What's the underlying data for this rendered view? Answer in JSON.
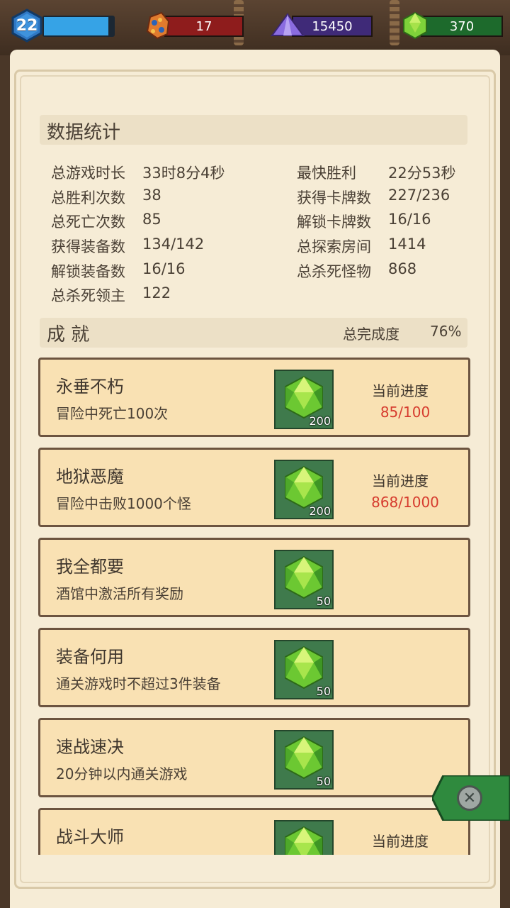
{
  "topbar": {
    "level": "22",
    "xp_fraction": 0.93,
    "resources": [
      {
        "name": "ore",
        "icon": "ore-icon",
        "value": "17",
        "color": "#8e1c1c"
      },
      {
        "name": "crystal",
        "icon": "purple-crystal-icon",
        "value": "15450",
        "color": "#3f2a78"
      },
      {
        "name": "gem",
        "icon": "green-gem-icon",
        "value": "370",
        "color": "#1d6a2c"
      }
    ]
  },
  "stats": {
    "title": "数据统计",
    "left": [
      {
        "label": "总游戏时长",
        "value": "33时8分4秒"
      },
      {
        "label": "总胜利次数",
        "value": "38"
      },
      {
        "label": "总死亡次数",
        "value": "85"
      },
      {
        "label": "获得装备数",
        "value": "134/142"
      },
      {
        "label": "解锁装备数",
        "value": "16/16"
      },
      {
        "label": "总杀死领主",
        "value": "122"
      }
    ],
    "right": [
      {
        "label": "最快胜利",
        "value": "22分53秒"
      },
      {
        "label": "获得卡牌数",
        "value": "227/236"
      },
      {
        "label": "解锁卡牌数",
        "value": "16/16"
      },
      {
        "label": "总探索房间",
        "value": "1414"
      },
      {
        "label": "总杀死怪物",
        "value": "868"
      }
    ]
  },
  "achievements": {
    "title": "成 就",
    "completion_label": "总完成度",
    "completion_value": "76%",
    "items": [
      {
        "title": "永垂不朽",
        "desc": "冒险中死亡100次",
        "reward": "200",
        "progress_label": "当前进度",
        "progress": "85/100"
      },
      {
        "title": "地狱恶魔",
        "desc": "冒险中击败1000个怪",
        "reward": "200",
        "progress_label": "当前进度",
        "progress": "868/1000"
      },
      {
        "title": "我全都要",
        "desc": "酒馆中激活所有奖励",
        "reward": "50",
        "progress_label": "",
        "progress": ""
      },
      {
        "title": "装备何用",
        "desc": "通关游戏时不超过3件装备",
        "reward": "50",
        "progress_label": "",
        "progress": ""
      },
      {
        "title": "速战速决",
        "desc": "20分钟以内通关游戏",
        "reward": "50",
        "progress_label": "",
        "progress": ""
      },
      {
        "title": "战斗大师",
        "desc": "",
        "reward": "",
        "progress_label": "当前进度",
        "progress": ""
      }
    ]
  },
  "close": {
    "icon": "close-icon",
    "glyph": "✕"
  }
}
